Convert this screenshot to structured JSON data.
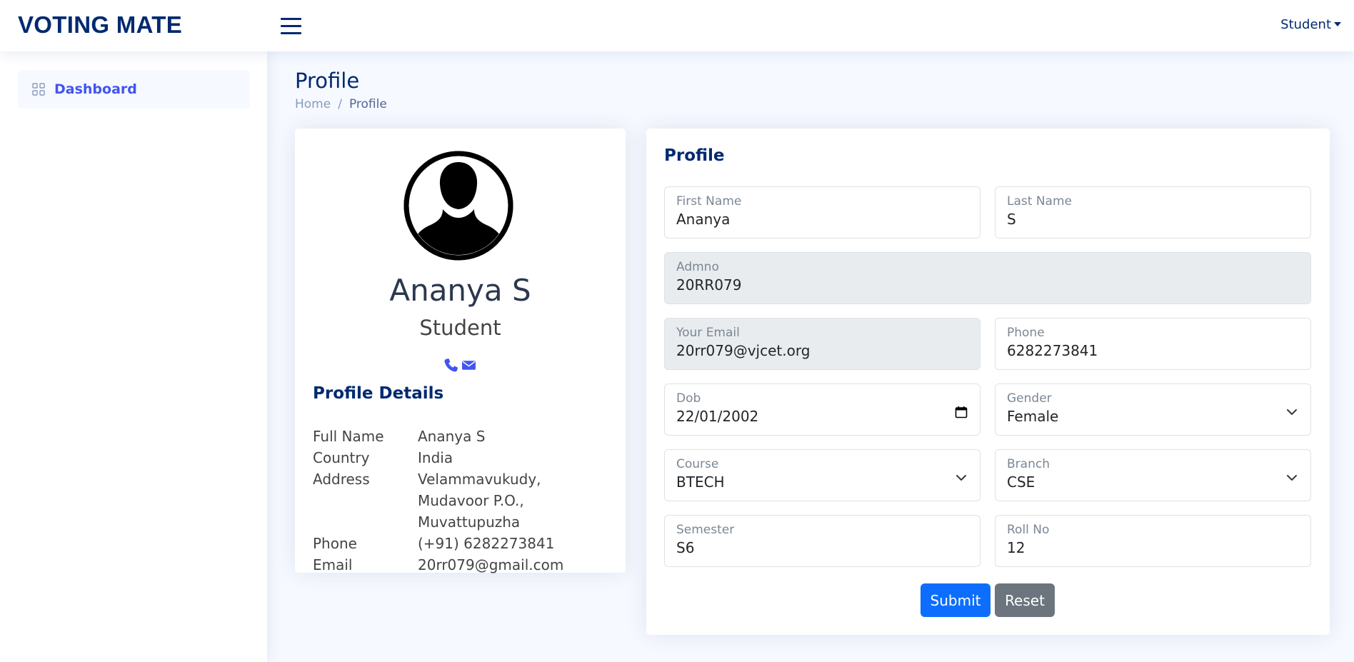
{
  "header": {
    "logo": "VOTING MATE",
    "menu_icon": "hamburger-icon",
    "user_label": "Student"
  },
  "sidebar": {
    "items": [
      {
        "label": "Dashboard",
        "icon": "grid-icon"
      }
    ]
  },
  "page": {
    "title": "Profile",
    "breadcrumb": [
      "Home",
      "Profile"
    ]
  },
  "profile_card": {
    "name": "Ananya S",
    "role": "Student",
    "avatar_icon": "user-silhouette-icon",
    "social_icons": [
      "phone-icon",
      "envelope-icon"
    ],
    "details_title": "Profile Details",
    "details": [
      {
        "label": "Full Name",
        "value": "Ananya S"
      },
      {
        "label": "Country",
        "value": "India"
      },
      {
        "label": "Address",
        "value": "Velammavukudy, Mudavoor P.O., Muvattupuzha"
      },
      {
        "label": "Phone",
        "value": "(+91) 6282273841"
      },
      {
        "label": "Email",
        "value": "20rr079@gmail.com"
      }
    ]
  },
  "form": {
    "title": "Profile",
    "first_name": {
      "label": "First Name",
      "value": "Ananya"
    },
    "last_name": {
      "label": "Last Name",
      "value": "S"
    },
    "admno": {
      "label": "Admno",
      "value": "20RR079"
    },
    "email": {
      "label": "Your Email",
      "value": "20rr079@vjcet.org"
    },
    "phone": {
      "label": "Phone",
      "value": "6282273841"
    },
    "dob": {
      "label": "Dob",
      "value": "22/01/2002",
      "icon": "calendar-icon"
    },
    "gender": {
      "label": "Gender",
      "value": "Female",
      "icon": "chevron-down-icon"
    },
    "course": {
      "label": "Course",
      "value": "BTECH",
      "icon": "chevron-down-icon"
    },
    "branch": {
      "label": "Branch",
      "value": "CSE",
      "icon": "chevron-down-icon"
    },
    "semester": {
      "label": "Semester",
      "value": "S6"
    },
    "roll_no": {
      "label": "Roll No",
      "value": "12"
    },
    "submit_label": "Submit",
    "reset_label": "Reset"
  },
  "colors": {
    "brand": "#012970",
    "accent": "#4154f1",
    "primary_button": "#0d6efd",
    "secondary_button": "#6c757d",
    "page_background": "#f6f9ff"
  }
}
